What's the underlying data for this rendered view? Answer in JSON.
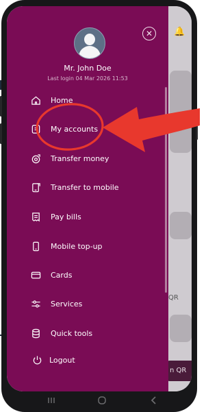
{
  "user": {
    "name": "Mr. John Doe",
    "last_login": "Last login 04 Mar 2026 11:53"
  },
  "menu": [
    {
      "label": "Home",
      "icon": "home-icon"
    },
    {
      "label": "My accounts",
      "icon": "accounts-icon"
    },
    {
      "label": "Transfer money",
      "icon": "transfer-money-icon"
    },
    {
      "label": "Transfer to mobile",
      "icon": "transfer-mobile-icon"
    },
    {
      "label": "Pay bills",
      "icon": "bill-icon"
    },
    {
      "label": "Mobile top-up",
      "icon": "mobile-icon"
    },
    {
      "label": "Cards",
      "icon": "card-icon"
    },
    {
      "label": "Services",
      "icon": "services-icon"
    },
    {
      "label": "Quick tools",
      "icon": "database-icon"
    }
  ],
  "logout": {
    "label": "Logout",
    "icon": "power-icon"
  },
  "background_app": {
    "qr_button": "n QR",
    "qr_label": "QR"
  },
  "colors": {
    "drawer": "#7a0c55",
    "annotation": "#e8382d",
    "phone_frame": "#171719"
  }
}
